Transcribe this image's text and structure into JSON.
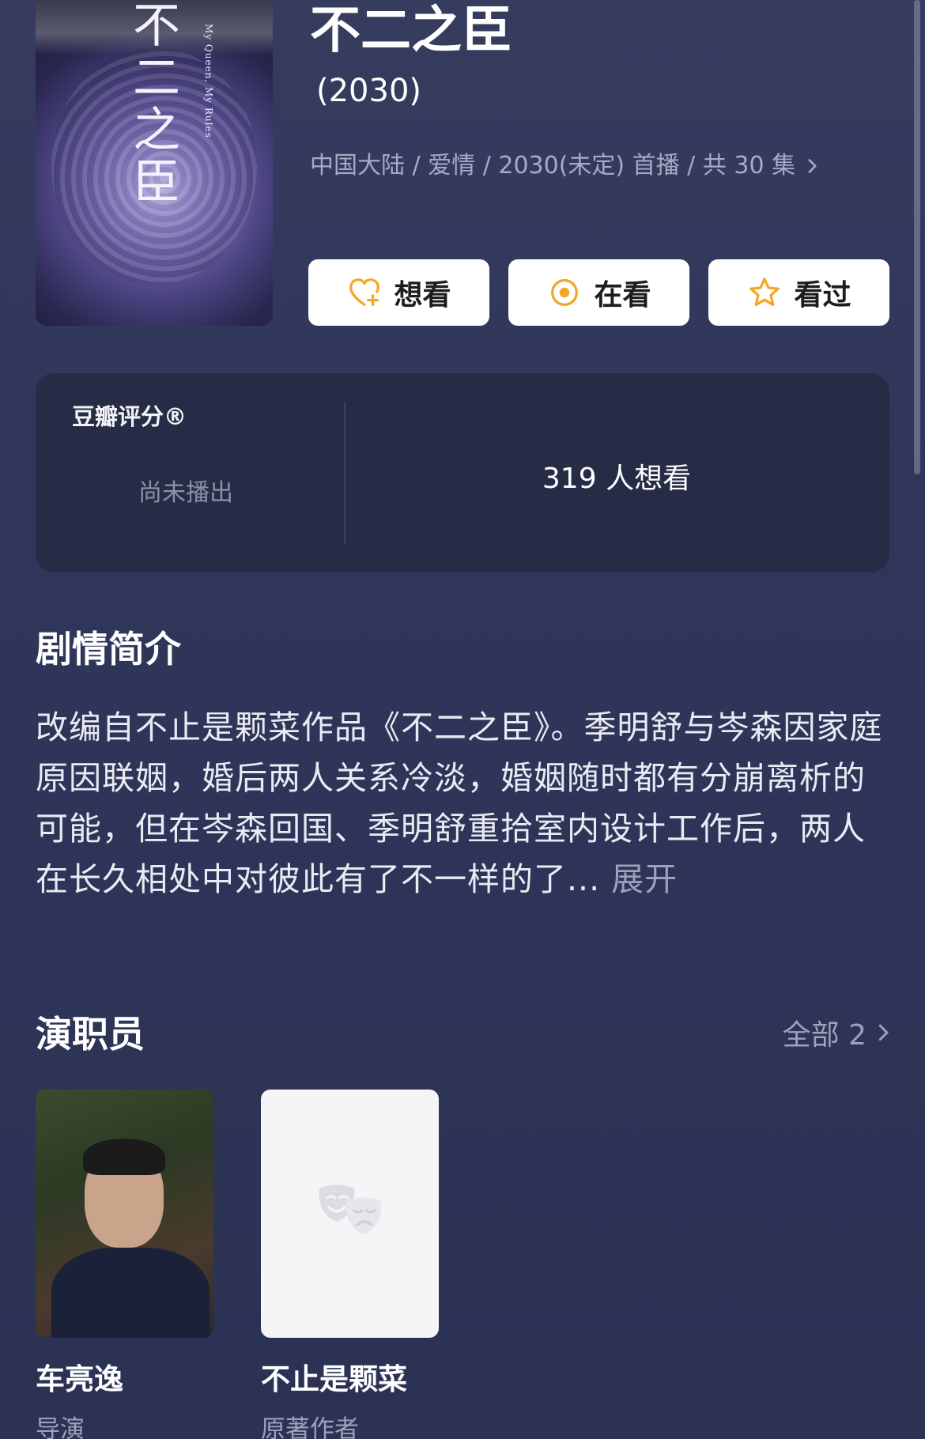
{
  "poster": {
    "title_text": "不二之臣",
    "subtitle_text": "My Queen, My Rules"
  },
  "show": {
    "title": "不二之臣",
    "year": "(2030)",
    "meta": "中国大陆 / 爱情 / 2030(未定) 首播 / 共 30 集"
  },
  "actions": {
    "want_label": "想看",
    "watching_label": "在看",
    "watched_label": "看过",
    "accent_color": "#f5a623"
  },
  "rating": {
    "label": "豆瓣评分®",
    "status": "尚未播出",
    "wish_count": "319 人想看"
  },
  "synopsis": {
    "heading": "剧情简介",
    "text": "改编自不止是颗菜作品《不二之臣》。季明舒与岑森因家庭原因联姻，婚后两人关系冷淡，婚姻随时都有分崩离析的可能，但在岑森回国、季明舒重拾室内设计工作后，两人在长久相处中对彼此有了不一样的了...",
    "expand_label": "展开"
  },
  "cast": {
    "heading": "演职员",
    "all_label": "全部 2",
    "members": [
      {
        "name": "车亮逸",
        "role": "导演"
      },
      {
        "name": "不止是颗菜",
        "role": "原著作者"
      }
    ]
  }
}
